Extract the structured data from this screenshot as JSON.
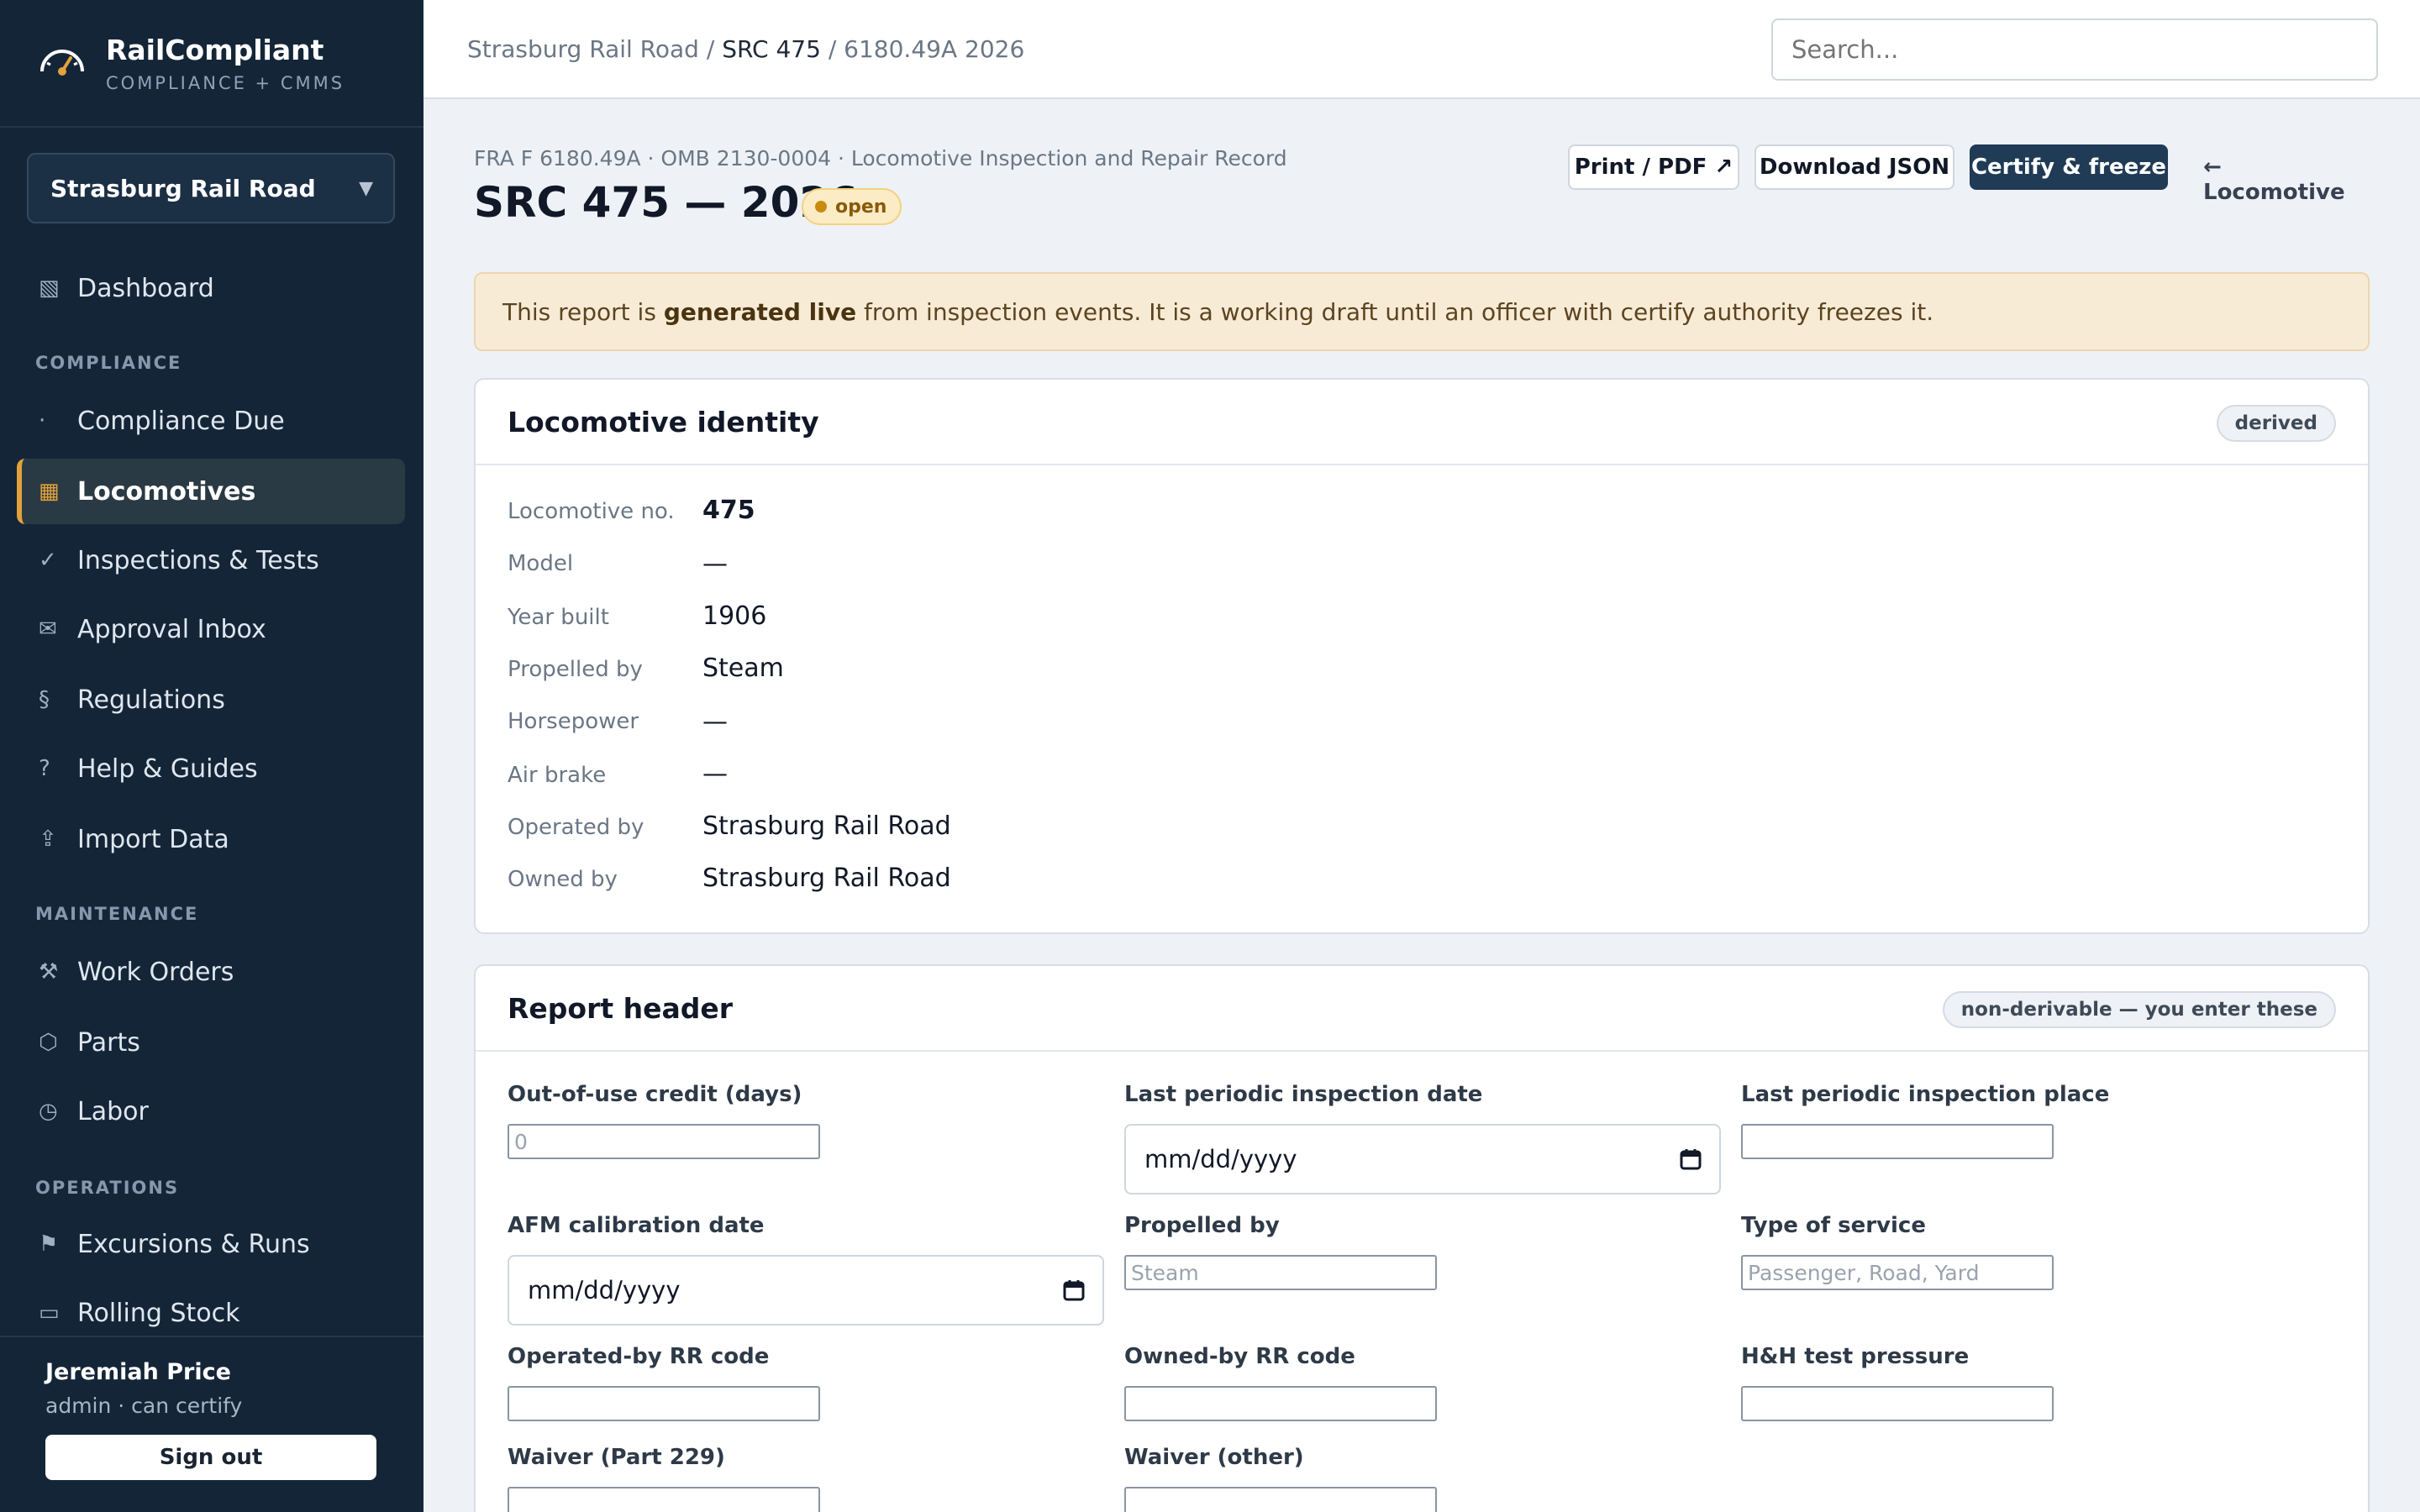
{
  "brand": {
    "name": "RailCompliant",
    "subtitle": "COMPLIANCE + CMMS"
  },
  "org_selector": {
    "value": "Strasburg Rail Road"
  },
  "nav": {
    "dashboard": "Dashboard",
    "section_compliance": "COMPLIANCE",
    "compliance_due": "Compliance Due",
    "locomotives": "Locomotives",
    "inspections": "Inspections & Tests",
    "approval_inbox": "Approval Inbox",
    "regulations": "Regulations",
    "help": "Help & Guides",
    "import": "Import Data",
    "section_maintenance": "MAINTENANCE",
    "work_orders": "Work Orders",
    "parts": "Parts",
    "labor": "Labor",
    "section_operations": "OPERATIONS",
    "excursions": "Excursions & Runs",
    "rolling_stock": "Rolling Stock"
  },
  "nav_icons": {
    "dashboard": "▧",
    "compliance_due": "·",
    "locomotives": "▦",
    "inspections": "✓",
    "approval_inbox": "✉",
    "regulations": "§",
    "help": "?",
    "import": "⇪",
    "work_orders": "⚒",
    "parts": "⬡",
    "labor": "◷",
    "excursions": "⚑",
    "rolling_stock": "▭"
  },
  "user": {
    "name": "Jeremiah Price",
    "role": "admin · can certify",
    "sign_out": "Sign out"
  },
  "breadcrumb": {
    "org": "Strasburg Rail Road",
    "sep1": " / ",
    "loco": "SRC 475",
    "sep2": " / ",
    "report": "6180.49A 2026"
  },
  "search": {
    "placeholder": "Search..."
  },
  "report": {
    "form_line": "FRA F 6180.49A · OMB 2130-0004 · Locomotive Inspection and Repair Record",
    "title": "SRC 475 — 2026",
    "status": "open",
    "actions": {
      "print": "Print / PDF ↗",
      "download": "Download JSON",
      "certify": "Certify & freeze",
      "back": "← Locomotive"
    }
  },
  "banner": {
    "pre": "This report is ",
    "bold": "generated live",
    "post": " from inspection events. It is a working draft until an officer with certify authority freezes it."
  },
  "identity": {
    "title": "Locomotive identity",
    "tag": "derived",
    "rows": [
      {
        "label": "Locomotive no.",
        "value": "475"
      },
      {
        "label": "Model",
        "value": "—"
      },
      {
        "label": "Year built",
        "value": "1906"
      },
      {
        "label": "Propelled by",
        "value": "Steam"
      },
      {
        "label": "Horsepower",
        "value": "—"
      },
      {
        "label": "Air brake",
        "value": "—"
      },
      {
        "label": "Operated by",
        "value": "Strasburg Rail Road"
      },
      {
        "label": "Owned by",
        "value": "Strasburg Rail Road"
      }
    ]
  },
  "header_form": {
    "title": "Report header",
    "tag": "non-derivable — you enter these",
    "out_of_use": {
      "label": "Out-of-use credit (days)",
      "placeholder": "0"
    },
    "last_periodic_date": {
      "label": "Last periodic inspection date",
      "value": "mm/dd/yyyy"
    },
    "last_periodic_place": {
      "label": "Last periodic inspection place",
      "placeholder": ""
    },
    "afm_date": {
      "label": "AFM calibration date",
      "value": "mm/dd/yyyy"
    },
    "propelled_by": {
      "label": "Propelled by",
      "placeholder": "Steam"
    },
    "type_of_service": {
      "label": "Type of service",
      "placeholder": "Passenger, Road, Yard"
    },
    "operated_rr": {
      "label": "Operated-by RR code",
      "placeholder": ""
    },
    "owned_rr": {
      "label": "Owned-by RR code",
      "placeholder": ""
    },
    "hh_pressure": {
      "label": "H&H test pressure",
      "placeholder": ""
    },
    "waiver_229": {
      "label": "Waiver (Part 229)"
    },
    "waiver_other": {
      "label": "Waiver (other)"
    }
  }
}
